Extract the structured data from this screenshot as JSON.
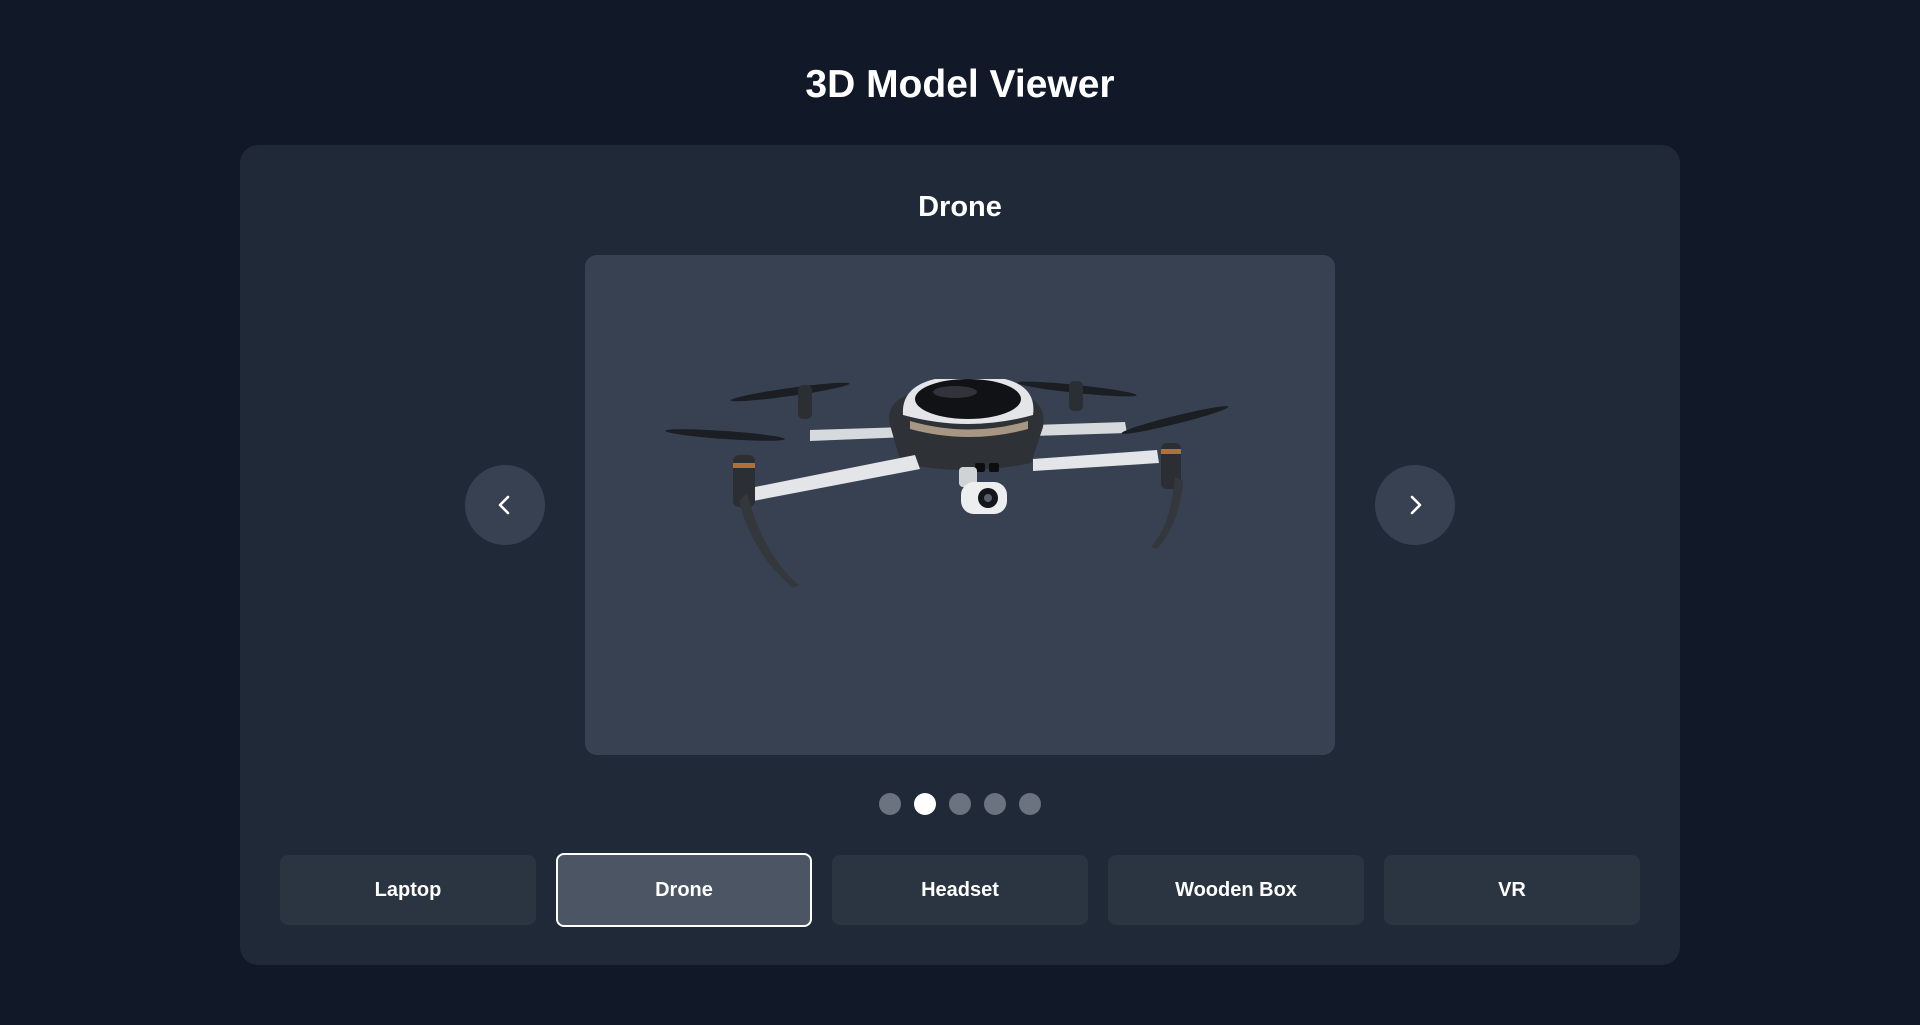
{
  "page": {
    "title": "3D Model Viewer"
  },
  "viewer": {
    "current_model": "Drone",
    "prev_icon": "chevron-left-icon",
    "next_icon": "chevron-right-icon",
    "active_index": 1,
    "dot_count": 5
  },
  "models": [
    {
      "label": "Laptop",
      "active": false
    },
    {
      "label": "Drone",
      "active": true
    },
    {
      "label": "Headset",
      "active": false
    },
    {
      "label": "Wooden Box",
      "active": false
    },
    {
      "label": "VR",
      "active": false
    }
  ],
  "colors": {
    "background": "#111827",
    "card": "#1f2937",
    "viewer": "#374151",
    "button": "#2b3441",
    "button_active": "#4b5563",
    "dot": "#6b7280",
    "dot_active": "#ffffff"
  }
}
